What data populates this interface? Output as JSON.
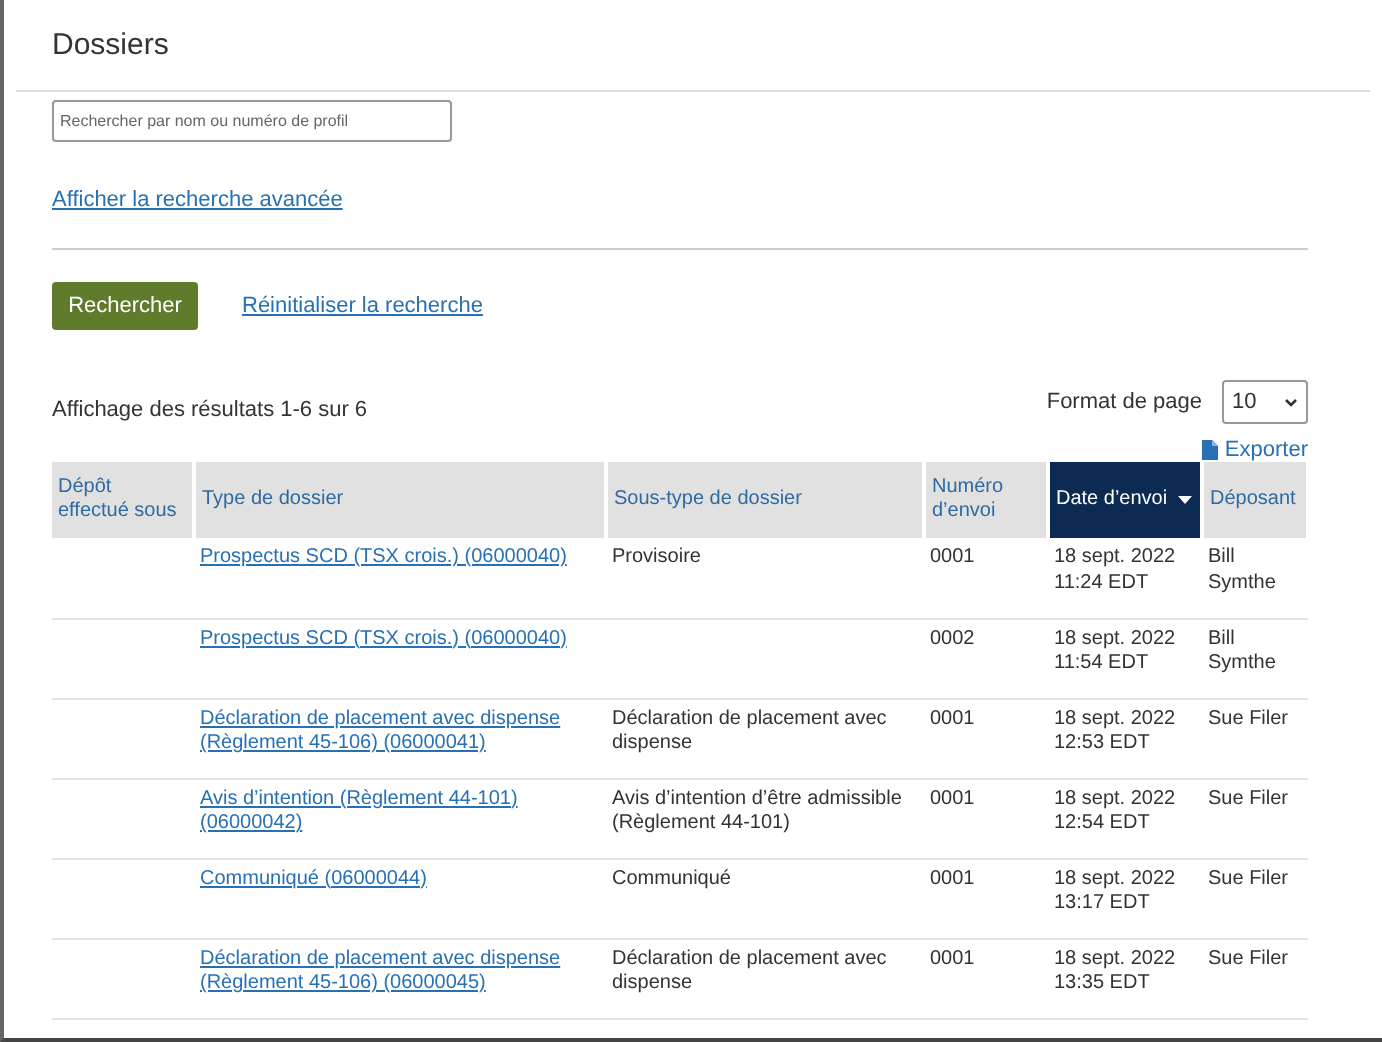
{
  "title": "Dossiers",
  "search": {
    "placeholder": "Rechercher par nom ou numéro de profil"
  },
  "advanced_link": "Afficher la recherche avancée",
  "search_button": "Rechercher",
  "reset_link": "Réinitialiser la recherche",
  "results_summary": "Affichage des résultats 1-6 sur 6",
  "page_size": {
    "label": "Format de page",
    "value": "10"
  },
  "export_link": "Exporter",
  "table": {
    "columns": [
      {
        "label": "Dépôt effectué sous",
        "sorted": false
      },
      {
        "label": "Type de dossier",
        "sorted": false
      },
      {
        "label": "Sous-type de dossier",
        "sorted": false
      },
      {
        "label": "Numéro d’envoi",
        "sorted": false
      },
      {
        "label": "Date d’envoi",
        "sorted": true
      },
      {
        "label": "Déposant",
        "sorted": false
      }
    ],
    "rows": [
      {
        "type": "Prospectus SCD (TSX crois.) (06000040)",
        "subtype": "Provisoire",
        "number": "0001",
        "date": "18 sept. 2022 11:24 EDT",
        "filer": "Bill Symthe"
      },
      {
        "type": "Prospectus SCD (TSX crois.) (06000040)",
        "number": "0002",
        "date": "18 sept. 2022 11:54 EDT",
        "filer": "Bill Symthe"
      },
      {
        "type": "Déclaration de placement avec dispense (Règlement 45-106) (06000041)",
        "subtype": "Déclaration de placement avec dispense",
        "number": "0001",
        "date": "18 sept. 2022 12:53 EDT",
        "filer": "Sue Filer"
      },
      {
        "type": "Avis d’intention (Règlement 44-101) (06000042)",
        "subtype": "Avis d’intention d’être admissible (Règlement 44-101)",
        "number": "0001",
        "date": "18 sept. 2022 12:54 EDT",
        "filer": "Sue Filer"
      },
      {
        "type": "Communiqué (06000044)",
        "subtype": "Communiqué",
        "number": "0001",
        "date": "18 sept. 2022 13:17 EDT",
        "filer": "Sue Filer"
      },
      {
        "type": "Déclaration de placement avec dispense (Règlement 45-106) (06000045)",
        "subtype": "Déclaration de placement avec dispense",
        "number": "0001",
        "date": "18 sept. 2022 13:35 EDT",
        "filer": "Sue Filer"
      }
    ]
  }
}
